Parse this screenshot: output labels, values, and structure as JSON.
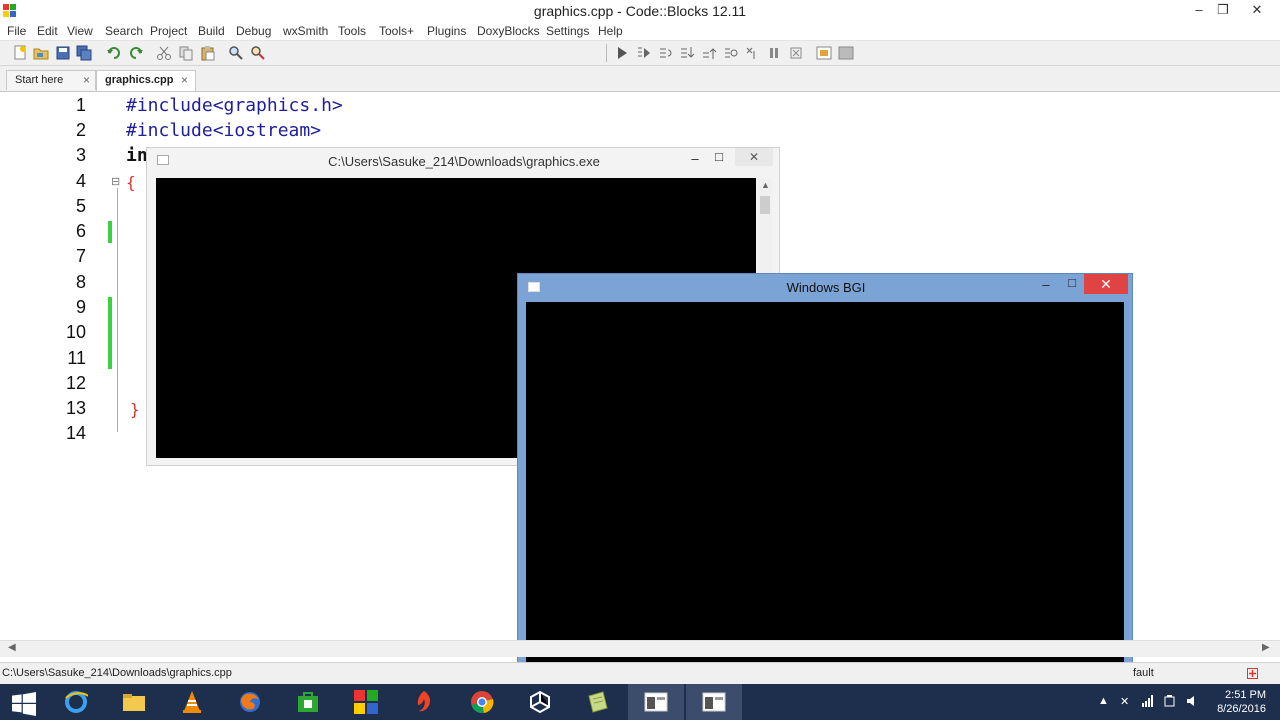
{
  "app": {
    "title": "graphics.cpp - Code::Blocks 12.11",
    "window_controls": {
      "minimize": "–",
      "maximize": "❐",
      "close": "✕"
    }
  },
  "menu": [
    "File",
    "Edit",
    "View",
    "Search",
    "Project",
    "Build",
    "Debug",
    "wxSmith",
    "Tools",
    "Tools+",
    "Plugins",
    "DoxyBlocks",
    "Settings",
    "Help"
  ],
  "toolbar": {
    "left_icons": [
      "new-file-icon",
      "open-icon",
      "save-icon",
      "save-all-icon",
      "undo-icon",
      "redo-icon",
      "cut-icon",
      "copy-icon",
      "paste-icon",
      "find-icon",
      "replace-icon"
    ],
    "right_icons": [
      "debug-run-icon",
      "run-to-cursor-icon",
      "next-line-icon",
      "step-into-icon",
      "step-out-icon",
      "next-instruction-icon",
      "step-instruction-icon",
      "break-icon",
      "stop-debug-icon",
      "debug-windows-icon",
      "various-info-icon"
    ]
  },
  "tabs": [
    {
      "label": "Start here",
      "close": "×",
      "active": false
    },
    {
      "label": "graphics.cpp",
      "close": "×",
      "active": true
    }
  ],
  "editor": {
    "line_numbers": [
      "1",
      "2",
      "3",
      "4",
      "5",
      "6",
      "7",
      "8",
      "9",
      "10",
      "11",
      "12",
      "13",
      "14"
    ],
    "visible_code": {
      "line1": "#include<graphics.h>",
      "line2": "#include<iostream>",
      "line3": "in",
      "line4": "{",
      "line13": "}"
    },
    "fold_marker": "⊟"
  },
  "console_window": {
    "title": "C:\\Users\\Sasuke_214\\Downloads\\graphics.exe",
    "minimize": "–",
    "maximize": "□",
    "close": "✕"
  },
  "bgi_window": {
    "title": "Windows BGI",
    "minimize": "–",
    "maximize": "□",
    "close": "✕"
  },
  "statusbar": {
    "path": "C:\\Users\\Sasuke_214\\Downloads\\graphics.cpp",
    "right_text": "fault"
  },
  "taskbar": {
    "apps": [
      "start-icon",
      "internet-explorer-icon",
      "file-explorer-icon",
      "vlc-icon",
      "firefox-icon",
      "store-icon",
      "codeblocks-icon",
      "browser-icon",
      "chrome-icon",
      "unity-icon",
      "notepad-icon",
      "console-window-icon",
      "bgi-window-icon"
    ],
    "time": "2:51 PM",
    "date": "8/26/2016"
  },
  "colors": {
    "code_blue": "#1e1e9e",
    "brace_red": "#e03030",
    "change_marker_green": "#3ed13e",
    "bgi_frame": "#7ba3d6",
    "taskbar": "#1e2f4e"
  }
}
